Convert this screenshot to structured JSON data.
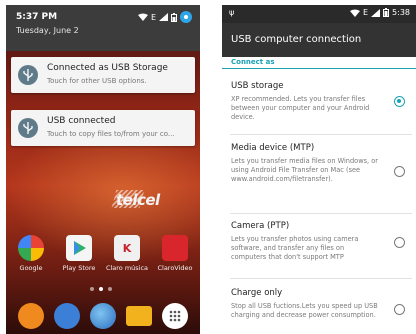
{
  "left_phone": {
    "status": {
      "time": "5:37 PM",
      "date": "Tuesday, June 2",
      "network": "E",
      "icons": [
        "wifi-icon",
        "signal-icon",
        "battery-icon",
        "user-avatar-icon"
      ]
    },
    "notifications": [
      {
        "icon": "usb-icon",
        "title": "Connected as USB Storage",
        "text": "Touch for other USB options."
      },
      {
        "icon": "usb-icon",
        "title": "USB connected",
        "text": "Touch to copy files to/from your co..."
      }
    ],
    "wallpaper_logo": "telcel",
    "apps": [
      {
        "label": "Google",
        "color": "#e8e8e8"
      },
      {
        "label": "Play Store",
        "color": "#f5f5f5"
      },
      {
        "label": "Claro música",
        "color": "#f0f0f0"
      },
      {
        "label": "ClaroVideo",
        "color": "#d9262c"
      }
    ],
    "pager_pages": 3,
    "pager_active": 2,
    "dock": [
      {
        "name": "phone-icon",
        "color": "#f08a1e"
      },
      {
        "name": "messenger-icon",
        "color": "#3b7fd6"
      },
      {
        "name": "browser-icon",
        "color": "#3d8dd9"
      },
      {
        "name": "email-icon",
        "color": "#f2b21d"
      },
      {
        "name": "app-drawer-icon",
        "color": "#ffffff"
      }
    ]
  },
  "right_phone": {
    "status": {
      "usb": "ψ",
      "network": "E",
      "time": "5:38"
    },
    "title": "USB computer connection",
    "section": "Connect as",
    "options": [
      {
        "title": "USB storage",
        "desc": "XP recommended. Lets you transfer files between your computer and your Android device.",
        "selected": true
      },
      {
        "title": "Media device (MTP)",
        "desc": "Lets you transfer media files on Windows, or using Android File Transfer on Mac (see www.android.com/filetransfer).",
        "selected": false
      },
      {
        "title": "Camera (PTP)",
        "desc": "Lets you transfer photos using camera software, and transfer any files on computers that don't support MTP",
        "selected": false
      },
      {
        "title": "Charge only",
        "desc": "Stop all USB fuctions.Lets you speed up USB charging and decrease power consumption.",
        "selected": false
      }
    ],
    "accent": "#1aa2b5"
  }
}
